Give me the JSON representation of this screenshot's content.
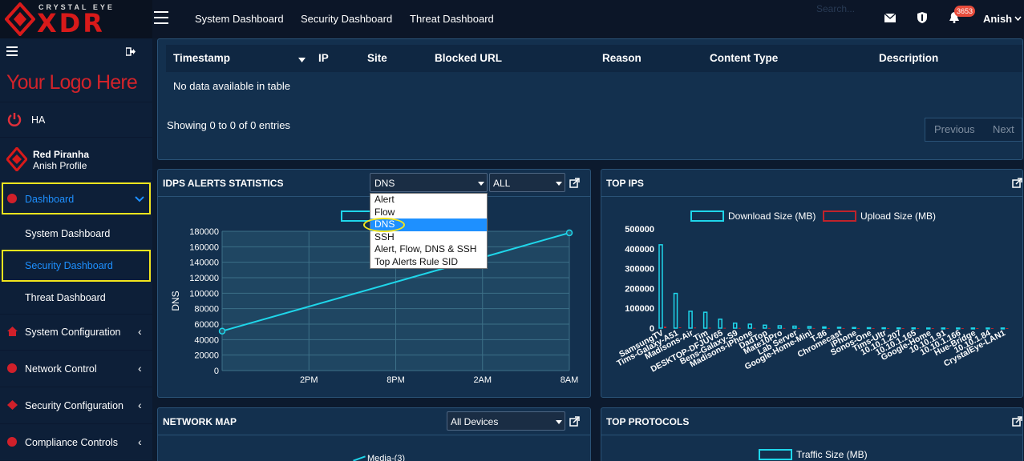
{
  "brand": {
    "small": "CRYSTAL EYE",
    "big": "XDR"
  },
  "topnav": {
    "items": [
      "System Dashboard",
      "Security Dashboard",
      "Threat Dashboard"
    ],
    "search_placeholder": "Search...",
    "badge": "3653",
    "user": "Anish"
  },
  "sidebar": {
    "logo_text": "Your Logo Here",
    "ha": "HA",
    "profile_name": "Red Piranha",
    "profile_sub": "Anish Profile",
    "dashboard": "Dashboard",
    "sub": [
      "System Dashboard",
      "Security Dashboard",
      "Threat Dashboard"
    ],
    "items": [
      "System Configuration",
      "Network Control",
      "Security Configuration",
      "Compliance Controls"
    ]
  },
  "table": {
    "columns": [
      "Timestamp",
      "IP",
      "Site",
      "Blocked URL",
      "Reason",
      "Content Type",
      "Description"
    ],
    "empty": "No data available in table",
    "showing": "Showing 0 to 0 of 0 entries",
    "previous": "Previous",
    "next": "Next"
  },
  "idps": {
    "title": "IDPS ALERTS STATISTICS",
    "select_value": "DNS",
    "select2_value": "ALL",
    "options": [
      "Alert",
      "Flow",
      "DNS",
      "SSH",
      "Alert, Flow, DNS & SSH",
      "Top Alerts Rule SID"
    ],
    "selected_index": 2
  },
  "topips": {
    "title": "TOP IPS",
    "legend": [
      "Download Size (MB)",
      "Upload Size (MB)"
    ]
  },
  "network_map": {
    "title": "NETWORK MAP",
    "select_value": "All Devices",
    "partial": "Media-(3)"
  },
  "top_protocols": {
    "title": "TOP PROTOCOLS",
    "legend": "Traffic Size (MB)"
  },
  "colors": {
    "accent": "#00bfff",
    "highlight": "#f2e51d",
    "red": "#d0202a",
    "line": "#1fd6ea"
  },
  "chart_data": [
    {
      "type": "line",
      "title": "IDPS ALERTS STATISTICS",
      "ylabel": "DNS",
      "x": [
        "start",
        "2PM",
        "8PM",
        "2AM",
        "8AM"
      ],
      "xticks": [
        "2PM",
        "8PM",
        "2AM",
        "8AM"
      ],
      "yticks": [
        0,
        20000,
        40000,
        60000,
        80000,
        100000,
        120000,
        140000,
        160000,
        180000
      ],
      "series": [
        {
          "values": [
            {
              "x": "start",
              "y": 51000
            },
            {
              "x": "8AM",
              "y": 178000
            }
          ]
        }
      ],
      "ylim": [
        0,
        180000
      ]
    },
    {
      "type": "bar",
      "title": "TOP IPS",
      "categories": [
        "SamsungTV",
        "Tims-Galaxy-A51",
        "Madisons-Air",
        "Tim",
        "DESKTOP-DFJUV65",
        "Bens-Galaxy-S9",
        "Madisons-iPhone",
        "DadTop",
        "Mate10Pro",
        "Lab Server",
        "Google-Home-Mini",
        "T-86",
        "Chromecast",
        "iPhone",
        "Sonos-One",
        "Tims-Ultr",
        "10.10.1.207",
        "10.10.1.165",
        "Google-Home",
        "10.10.1.91",
        "10.10.1.166",
        "Hue-Bridge",
        "10.10.1.84",
        "CrystalEye-LAN1"
      ],
      "yticks": [
        0,
        100000,
        200000,
        300000,
        400000,
        500000
      ],
      "series": [
        {
          "name": "Download Size (MB)",
          "values": [
            420000,
            175000,
            85000,
            80000,
            45000,
            25000,
            20000,
            15000,
            12000,
            10000,
            8000,
            6000,
            4000,
            3000,
            2000,
            1500,
            1000,
            1000,
            500,
            500,
            500,
            500,
            500,
            500
          ]
        },
        {
          "name": "Upload Size (MB)",
          "values": [
            8000,
            4000,
            3000,
            2000,
            1500,
            1000,
            1000,
            800,
            700,
            600,
            500,
            400,
            300,
            300,
            200,
            200,
            100,
            100,
            100,
            100,
            100,
            100,
            100,
            100
          ]
        }
      ],
      "ylim": [
        0,
        500000
      ]
    }
  ]
}
